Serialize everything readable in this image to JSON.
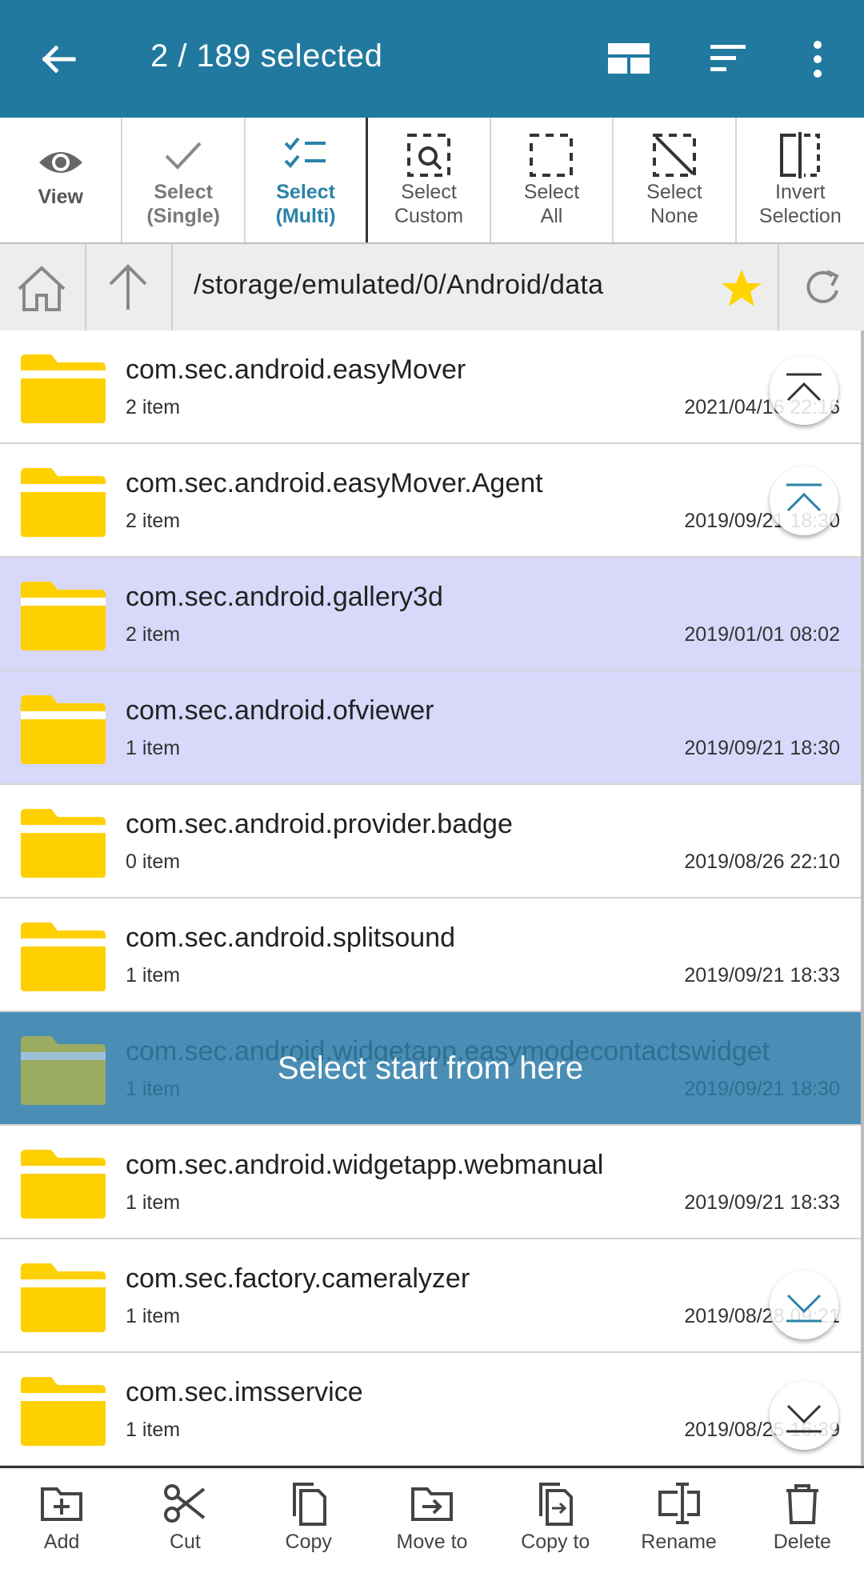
{
  "appbar": {
    "title": "2 / 189 selected",
    "icons": [
      "arrow-left-icon",
      "layout-icon",
      "sort-icon",
      "more-vert-icon"
    ],
    "color": "#21799f"
  },
  "select_tools": [
    {
      "label": "View"
    },
    {
      "label": "Select\n(Single)"
    },
    {
      "label": "Select\n(Multi)",
      "active": true
    },
    {
      "label": "Select\nCustom"
    },
    {
      "label": "Select\nAll"
    },
    {
      "label": "Select\nNone"
    },
    {
      "label": "Invert\nSelection"
    }
  ],
  "pathbar": {
    "path": "/storage/emulated/0/Android/data"
  },
  "files": [
    {
      "name": "com.sec.android.easyMover",
      "count": "2 item",
      "date": "2021/04/16 22:16",
      "selected": false
    },
    {
      "name": "com.sec.android.easyMover.Agent",
      "count": "2 item",
      "date": "2019/09/21 18:30",
      "selected": false
    },
    {
      "name": "com.sec.android.gallery3d",
      "count": "2 item",
      "date": "2019/01/01 08:02",
      "selected": true
    },
    {
      "name": "com.sec.android.ofviewer",
      "count": "1 item",
      "date": "2019/09/21 18:30",
      "selected": true
    },
    {
      "name": "com.sec.android.provider.badge",
      "count": "0 item",
      "date": "2019/08/26 22:10",
      "selected": false
    },
    {
      "name": "com.sec.android.splitsound",
      "count": "1 item",
      "date": "2019/09/21 18:33",
      "selected": false
    },
    {
      "name": "com.sec.android.widgetapp.easymodecontactswidget",
      "count": "1 item",
      "date": "2019/09/21 18:30",
      "selected": false
    },
    {
      "name": "com.sec.android.widgetapp.webmanual",
      "count": "1 item",
      "date": "2019/09/21 18:33",
      "selected": false
    },
    {
      "name": "com.sec.factory.cameralyzer",
      "count": "1 item",
      "date": "2019/08/28 09:21",
      "selected": false
    },
    {
      "name": "com.sec.imsservice",
      "count": "1 item",
      "date": "2019/08/25 16:39",
      "selected": false
    }
  ],
  "tip": "Select start from here",
  "bottom_actions": [
    {
      "label": "Add"
    },
    {
      "label": "Cut"
    },
    {
      "label": "Copy"
    },
    {
      "label": "Move to"
    },
    {
      "label": "Copy to"
    },
    {
      "label": "Rename"
    },
    {
      "label": "Delete"
    }
  ],
  "colors": {
    "selected_row": "#d8d8fb",
    "folder": "#ffd000",
    "tip_band": "#4a8eb5",
    "active_tool": "#2a83a8"
  }
}
